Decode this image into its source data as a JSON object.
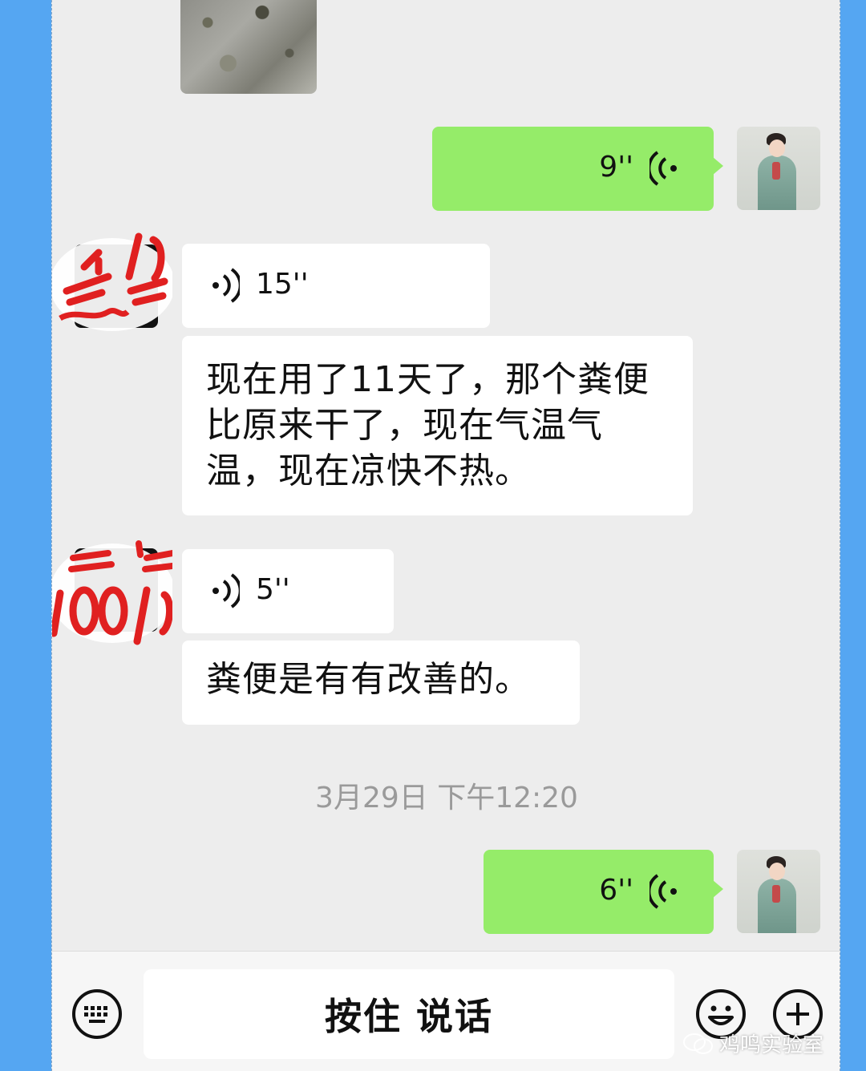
{
  "chat": {
    "messages": [
      {
        "type": "image",
        "sender": "other"
      },
      {
        "type": "voice",
        "sender": "me",
        "duration": "9''"
      },
      {
        "type": "voice",
        "sender": "other",
        "duration": "15''"
      },
      {
        "type": "text",
        "sender": "other",
        "lines": [
          "现在用了11天了，那个粪便",
          "比原来干了，现在气温气",
          "温，现在凉快不热。"
        ]
      },
      {
        "type": "voice",
        "sender": "other",
        "duration": "5''"
      },
      {
        "type": "text",
        "sender": "other",
        "lines": [
          "粪便是有有改善的。"
        ]
      },
      {
        "type": "voice",
        "sender": "me",
        "duration": "6''"
      }
    ],
    "timestamp": "3月29日 下午12:20"
  },
  "bottom_bar": {
    "hold_to_talk": "按住 说话"
  },
  "icons": {
    "keyboard": "keyboard-icon",
    "emoji": "emoji-icon",
    "plus": "plus-icon",
    "voice_wave": "voice-wave-icon"
  },
  "watermark": "鸡鸣实验室",
  "colors": {
    "sent_bubble": "#95ec69",
    "received_bubble": "#ffffff",
    "chat_background": "#ededed",
    "outer_background": "#55a6f2"
  }
}
